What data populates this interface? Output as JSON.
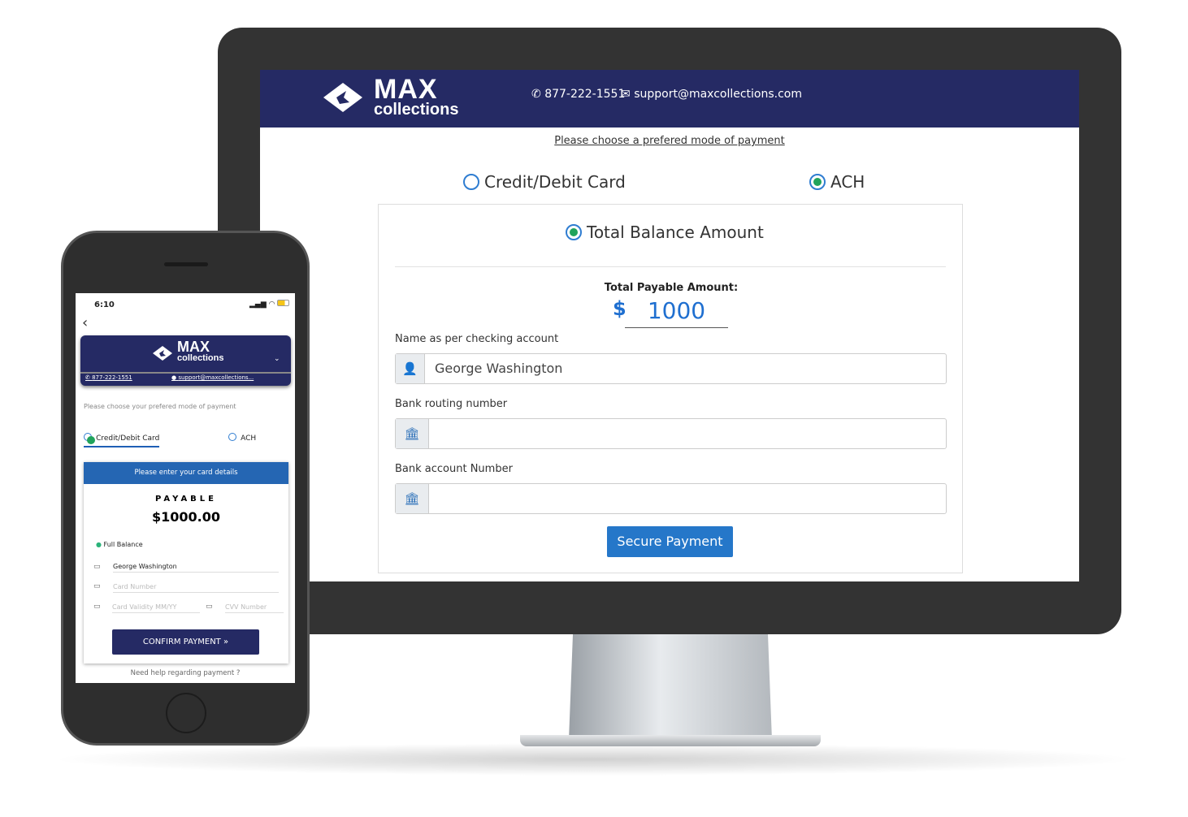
{
  "desktop": {
    "brand": {
      "name": "MAX",
      "sub": "collections"
    },
    "phone": "877-222-1551",
    "email": "support@maxcollections.com",
    "prompt": "Please choose a prefered mode of payment",
    "methods": [
      {
        "label": "Credit/Debit Card",
        "selected": false
      },
      {
        "label": "ACH",
        "selected": true
      }
    ],
    "balance_option": "Total Balance Amount",
    "payable_label": "Total Payable Amount:",
    "currency": "$",
    "amount": "1000",
    "fields": [
      {
        "label": "Name as per checking account",
        "value": "George Washington",
        "icon": "user-icon"
      },
      {
        "label": "Bank routing number",
        "value": "",
        "icon": "bank-icon"
      },
      {
        "label": "Bank account Number",
        "value": "",
        "icon": "bank-icon"
      }
    ],
    "submit": "Secure Payment",
    "colors": {
      "header": "#252a64",
      "accent": "#2577c9",
      "selected": "#21a35b"
    }
  },
  "mobile": {
    "time": "6:10",
    "brand": {
      "name": "MAX",
      "sub": "collections"
    },
    "phone": "877-222-1551",
    "email": "support@maxcollections...",
    "prompt": "Please choose your prefered mode of payment",
    "methods": [
      {
        "label": "Credit/Debit Card",
        "selected": true
      },
      {
        "label": "ACH",
        "selected": false
      }
    ],
    "card_header": "Please enter your card details",
    "payable_label": "PAYABLE",
    "amount": "$1000.00",
    "full_balance": "Full Balance",
    "name_value": "George Washington",
    "card_number_placeholder": "Card Number",
    "validity_placeholder": "Card Validity MM/YY",
    "cvv_placeholder": "CVV Number",
    "confirm": "CONFIRM PAYMENT",
    "help": "Need help regarding payment ?"
  }
}
